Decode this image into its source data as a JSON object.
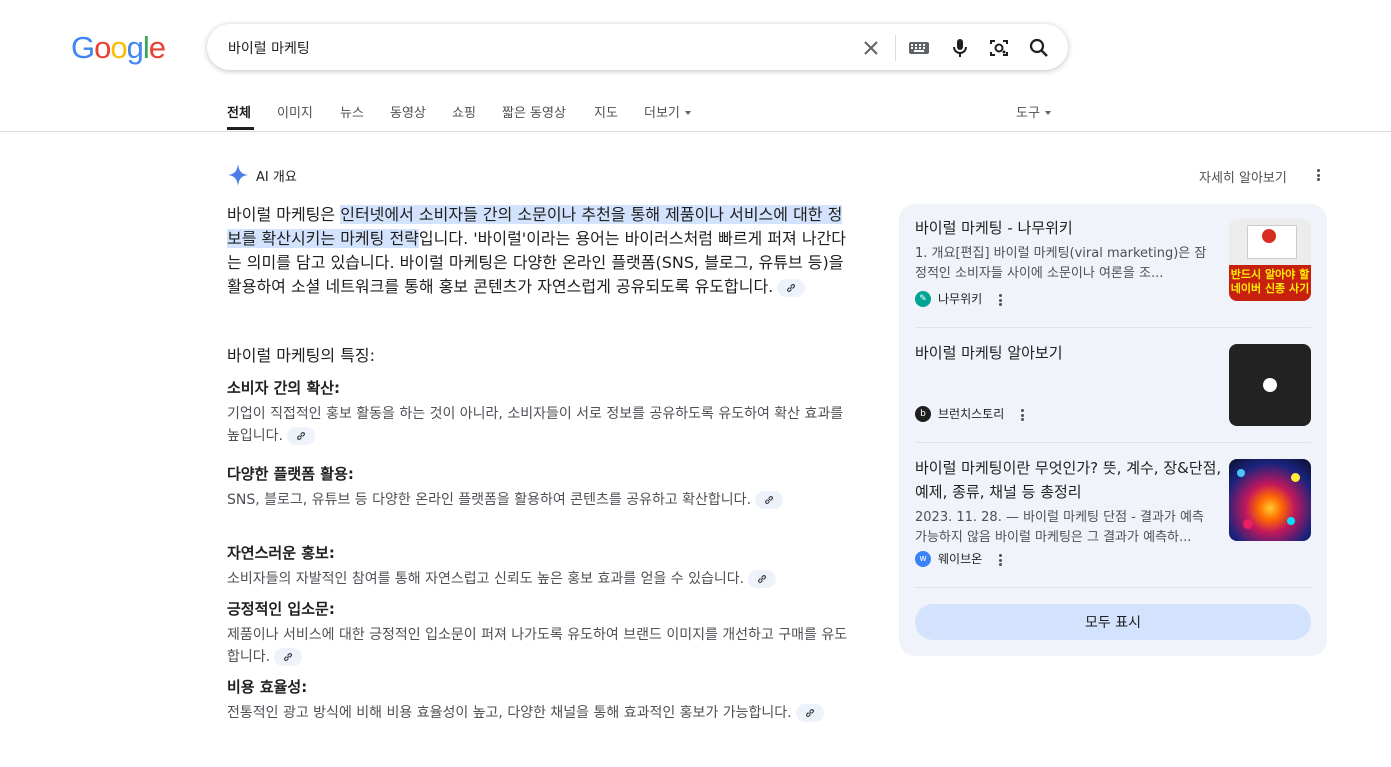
{
  "search": {
    "query": "바이럴 마케팅",
    "logo_text": "Google",
    "logo_colors": [
      "#4285F4",
      "#EA4335",
      "#FBBC05",
      "#4285F4",
      "#34A853",
      "#EA4335"
    ]
  },
  "tabs": [
    {
      "label": "전체",
      "active": true
    },
    {
      "label": "이미지"
    },
    {
      "label": "뉴스"
    },
    {
      "label": "동영상"
    },
    {
      "label": "쇼핑"
    },
    {
      "label": "짧은 동영상"
    },
    {
      "label": "지도"
    },
    {
      "label": "더보기"
    }
  ],
  "tools_label": "도구",
  "ai_overview": {
    "label": "AI 개요",
    "learn_more": "자세히 알아보기",
    "intro_prefix": "바이럴 마케팅은 ",
    "intro_highlight": "인터넷에서 소비자들 간의 소문이나 추천을 통해 제품이나 서비스에 대한 정보를 확산시키는 마케팅 전략",
    "intro_suffix": "입니다. '바이럴'이라는 용어는 바이러스처럼 빠르게 퍼져 나간다는 의미를 담고 있습니다. 바이럴 마케팅은 다양한 온라인 플랫폼(SNS, 블로그, 유튜브 등)을 활용하여 소셜 네트워크를 통해 홍보 콘텐츠가 자연스럽게 공유되도록 유도합니다.",
    "features_heading": "바이럴 마케팅의 특징:",
    "features": [
      {
        "title": "소비자 간의 확산:",
        "desc": "기업이 직접적인 홍보 활동을 하는 것이 아니라, 소비자들이 서로 정보를 공유하도록 유도하여 확산 효과를 높입니다."
      },
      {
        "title": "다양한 플랫폼 활용:",
        "desc": "SNS, 블로그, 유튜브 등 다양한 온라인 플랫폼을 활용하여 콘텐츠를 공유하고 확산합니다."
      },
      {
        "title": "자연스러운 홍보:",
        "desc": "소비자들의 자발적인 참여를 통해 자연스럽고 신뢰도 높은 홍보 효과를 얻을 수 있습니다."
      },
      {
        "title": "긍정적인 입소문:",
        "desc": "제품이나 서비스에 대한 긍정적인 입소문이 퍼져 나가도록 유도하여 브랜드 이미지를 개선하고 구매를 유도합니다."
      },
      {
        "title": "비용 효율성:",
        "desc": "전통적인 광고 방식에 비해 비용 효율성이 높고, 다양한 채널을 통해 효과적인 홍보가 가능합니다."
      }
    ]
  },
  "sources": [
    {
      "title": "바이럴 마케팅 - 나무위키",
      "snippet": "1. 개요[편집] 바이럴 마케팅(viral marketing)은 잠정적인 소비자들 사이에 소문이나 여론을 조...",
      "site": "나무위키",
      "fav_color": "#00a495",
      "thumb_caption": "반드시 알아야 할 네이버 신종 사기"
    },
    {
      "title": "바이럴 마케팅 알아보기",
      "snippet": "",
      "site": "브런치스토리",
      "fav_color": "#1f1f1f"
    },
    {
      "title": "바이럴 마케팅이란 무엇인가? 뜻, 계수, 장&단점, 예제, 종류, 채널 등 총정리",
      "snippet": "2023. 11. 28. — 바이럴 마케팅 단점 - 결과가 예측 가능하지 않음 바이럴 마케팅은 그 결과가 예측하...",
      "site": "웨이브온",
      "fav_color": "#3b82f6"
    }
  ],
  "show_all": "모두 표시"
}
